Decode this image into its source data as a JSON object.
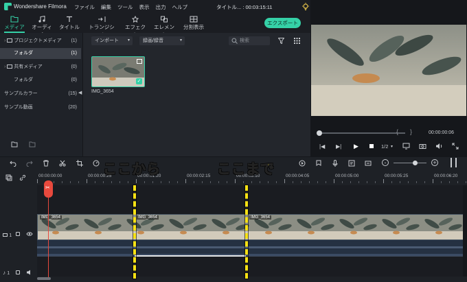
{
  "app": {
    "name": "Wondershare Filmora"
  },
  "menu": [
    "ファイル",
    "編集",
    "ツール",
    "表示",
    "出力",
    "ヘルプ"
  ],
  "title": "タイトル... : 00:03:15:11",
  "toolbar": {
    "tabs": [
      {
        "label": "メディア",
        "icon": "folder-icon",
        "active": true
      },
      {
        "label": "オーディオ",
        "icon": "music-note-icon"
      },
      {
        "label": "タイトル",
        "icon": "text-icon"
      },
      {
        "label": "トランジション",
        "icon": "transition-icon"
      },
      {
        "label": "エフェクト",
        "icon": "effect-star-icon"
      },
      {
        "label": "エレメント",
        "icon": "element-icon"
      },
      {
        "label": "分割表示",
        "icon": "split-screen-icon"
      }
    ],
    "export_label": "エクスポート"
  },
  "sidebar": {
    "items": [
      {
        "label": "プロジェクトメディア",
        "count": "(1)"
      },
      {
        "label": "フォルダ",
        "count": "(1)",
        "selected": true
      },
      {
        "label": "共有メディア",
        "count": "(0)"
      },
      {
        "label": "フォルダ",
        "count": "(0)"
      },
      {
        "label": "サンプルカラー",
        "count": "(15)"
      },
      {
        "label": "サンプル動画",
        "count": "(20)"
      }
    ]
  },
  "media": {
    "import_label": "インポート",
    "record_label": "録画/録音",
    "search_placeholder": "検索",
    "clip_name": "IMG_3654"
  },
  "preview": {
    "time": "00:00:00:06",
    "quality": "1/2"
  },
  "timeline": {
    "ruler": [
      "00:00:00:00",
      "00:00:00:25",
      "00:00:01:20",
      "00:00:02:15",
      "00:00:03:10",
      "00:00:04:05",
      "00:00:05:00",
      "00:00:05:25",
      "00:00:06:20"
    ],
    "clip_labels": [
      "IMG_3654",
      "IMG_3654",
      "IMG_3654"
    ],
    "track_num": "1",
    "audio_track_num": "1"
  },
  "annotations": {
    "from": "ここから",
    "to": "ここまで"
  },
  "colors": {
    "accent": "#35d1a7",
    "annotation": "#f8e214",
    "playhead": "#e8493d"
  }
}
